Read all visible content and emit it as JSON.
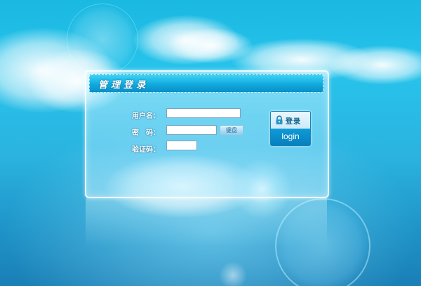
{
  "panel": {
    "title": "管理登录"
  },
  "form": {
    "username_label": "用户名：",
    "username_value": "",
    "password_label": "密　码：",
    "password_value": "",
    "keyboard_button": "键盘",
    "captcha_label": "验证码：",
    "captcha_value": ""
  },
  "login_button": {
    "label_cn": "登录",
    "label_en": "login",
    "icon": "lock-icon"
  },
  "colors": {
    "sky_top": "#1ab9e2",
    "sky_bottom": "#1a7fb6",
    "header_blue": "#11a9de",
    "login_blue": "#077fbd"
  }
}
